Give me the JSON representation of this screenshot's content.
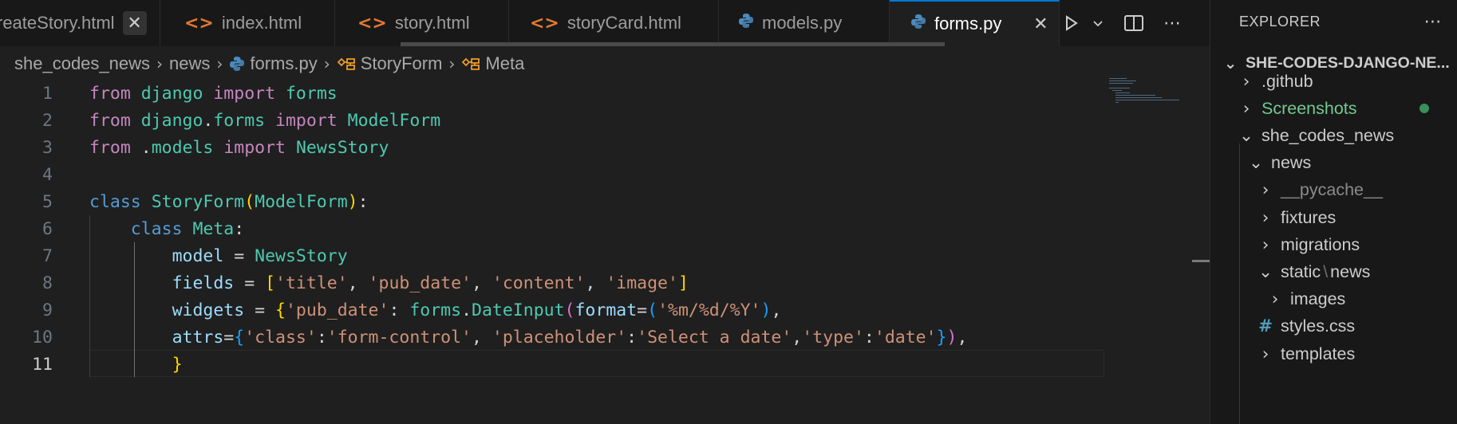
{
  "tabs": [
    {
      "label": "reateStory.html",
      "icon": "html-icon",
      "closable": true
    },
    {
      "label": "index.html",
      "icon": "html-icon"
    },
    {
      "label": "story.html",
      "icon": "html-icon"
    },
    {
      "label": "storyCard.html",
      "icon": "html-icon"
    },
    {
      "label": "models.py",
      "icon": "python-icon"
    },
    {
      "label": "forms.py",
      "icon": "python-icon",
      "active": true
    }
  ],
  "breadcrumb": [
    "she_codes_news",
    "news",
    "forms.py",
    "StoryForm",
    "Meta"
  ],
  "code": {
    "line_numbers": [
      "1",
      "2",
      "3",
      "4",
      "5",
      "6",
      "7",
      "8",
      "9",
      "10",
      "11"
    ],
    "lines": [
      "from django import forms",
      "from django.forms import ModelForm",
      "from .models import NewsStory",
      "",
      "class StoryForm(ModelForm):",
      "    class Meta:",
      "        model = NewsStory",
      "        fields = ['title', 'pub_date', 'content', 'image']",
      "        widgets = {'pub_date': forms.DateInput(format=('%m/%d/%Y'),",
      "        attrs={'class':'form-control', 'placeholder':'Select a date','type':'date'}),",
      "        }"
    ],
    "current_line": "11"
  },
  "explorer": {
    "title": "EXPLORER",
    "root": "SHE-CODES-DJANGO-NE...",
    "items": [
      {
        "label": ".github",
        "expanded": false
      },
      {
        "label": "Screenshots",
        "expanded": false,
        "git_modified": true
      },
      {
        "label": "she_codes_news",
        "expanded": true
      },
      {
        "label": "news",
        "expanded": true
      },
      {
        "label": "__pycache__",
        "expanded": false
      },
      {
        "label": "fixtures",
        "expanded": false
      },
      {
        "label": "migrations",
        "expanded": false
      },
      {
        "label_parts": [
          "static",
          "news"
        ],
        "separator": "\\",
        "expanded": true
      },
      {
        "label": "images",
        "expanded": false
      },
      {
        "label": "styles.css",
        "icon": "css-hash-icon"
      },
      {
        "label": "templates",
        "expanded": false
      }
    ]
  },
  "colors": {
    "accent": "#0078d4",
    "keyword": "#c586c0",
    "class_keyword": "#569cd6",
    "type": "#4ec9b0",
    "string": "#ce9178",
    "variable": "#9cdcfe",
    "git_added": "#73c991"
  }
}
